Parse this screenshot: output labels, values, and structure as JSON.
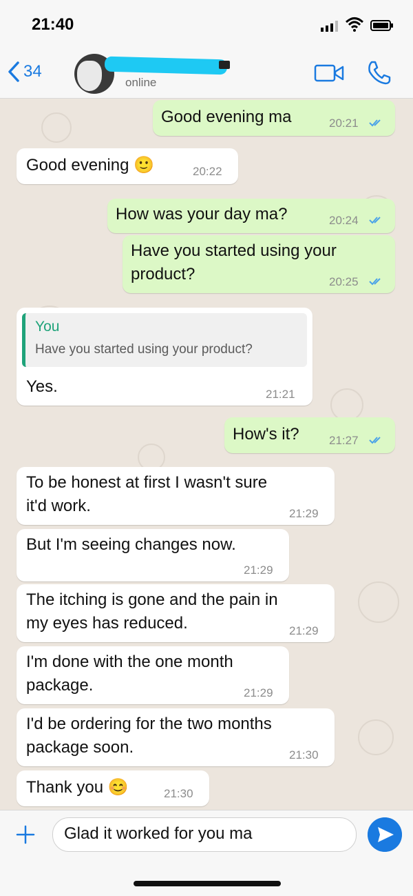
{
  "status_bar": {
    "time": "21:40"
  },
  "header": {
    "back_count": "34",
    "presence": "online"
  },
  "messages": [
    {
      "dir": "out",
      "text": "Good evening ma",
      "time": "20:21",
      "read": true
    },
    {
      "dir": "in",
      "text": "Good evening 🙂",
      "time": "20:22"
    },
    {
      "dir": "out",
      "text": "How was your day ma?",
      "time": "20:24",
      "read": true
    },
    {
      "dir": "out",
      "text": "Have you started using your\nproduct?",
      "time": "20:25",
      "read": true
    },
    {
      "dir": "in",
      "reply_to": {
        "author": "You",
        "text": "Have you started using your product?"
      },
      "text": "Yes.",
      "time": "21:21"
    },
    {
      "dir": "out",
      "text": "How's it?",
      "time": "21:27",
      "read": true
    },
    {
      "dir": "in",
      "text": "To be honest at first I wasn't sure\nit'd work.",
      "time": "21:29"
    },
    {
      "dir": "in",
      "text": "But I'm seeing changes now.",
      "time": "21:29"
    },
    {
      "dir": "in",
      "text": "The itching is gone and the pain in\nmy eyes has reduced.",
      "time": "21:29"
    },
    {
      "dir": "in",
      "text": "I'm done with the one month\npackage.",
      "time": "21:29"
    },
    {
      "dir": "in",
      "text": "I'd be ordering for the two months\npackage soon.",
      "time": "21:30"
    },
    {
      "dir": "in",
      "text": "Thank you 😊",
      "time": "21:30"
    }
  ],
  "composer": {
    "draft": "Glad it worked for you ma"
  },
  "colors": {
    "accent": "#1a7ae0",
    "outgoing_bubble": "#dcf8c6",
    "incoming_bubble": "#ffffff",
    "quote_accent": "#1fa37a",
    "chat_background": "#ece5dd"
  },
  "icons": [
    "back-chevron-icon",
    "video-call-icon",
    "phone-call-icon",
    "plus-icon",
    "send-icon",
    "double-check-icon"
  ]
}
